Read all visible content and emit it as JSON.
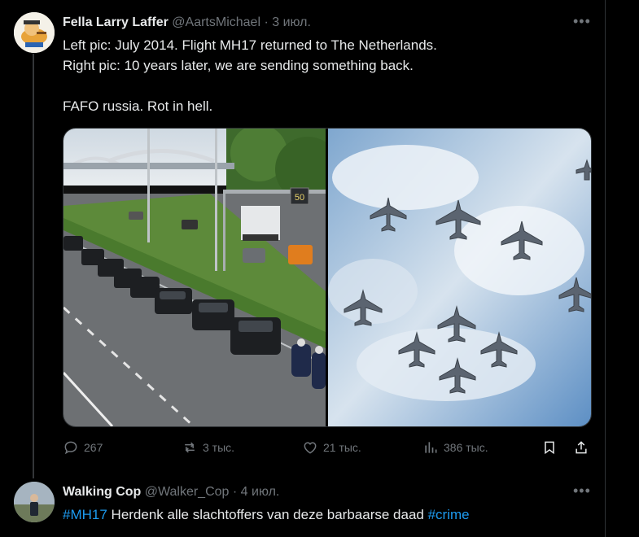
{
  "tweet1": {
    "display_name": "Fella Larry Laffer",
    "handle": "@AartsMichael",
    "separator": " · ",
    "date": "3 июл.",
    "line1": "Left pic: July 2014. Flight MH17 returned to The Netherlands.",
    "line2": "Right pic: 10 years later, we are sending something back.",
    "line3": "FAFO russia. Rot in hell.",
    "media": {
      "left_image": "convoy-of-hearses-on-highway",
      "right_image": "fighter-jets-formation-in-sky",
      "speed_sign": "50"
    },
    "stats": {
      "replies": "267",
      "reposts": "3 тыс.",
      "likes": "21 тыс.",
      "views": "386 тыс."
    }
  },
  "tweet2": {
    "display_name": "Walking Cop",
    "handle": "@Walker_Cop",
    "separator": " · ",
    "date": "4 июл.",
    "hashtag1": "#MH17",
    "body": " Herdenk alle slachtoffers van deze barbaarse daad ",
    "hashtag2": "#crime"
  },
  "icons": {
    "more": "more-icon",
    "reply": "reply-icon",
    "repost": "repost-icon",
    "like": "like-icon",
    "views": "views-icon",
    "bookmark": "bookmark-icon",
    "share": "share-icon"
  },
  "colors": {
    "accent": "#1d9bf0",
    "muted": "#71767b",
    "text": "#e7e9ea",
    "background": "#000000"
  }
}
